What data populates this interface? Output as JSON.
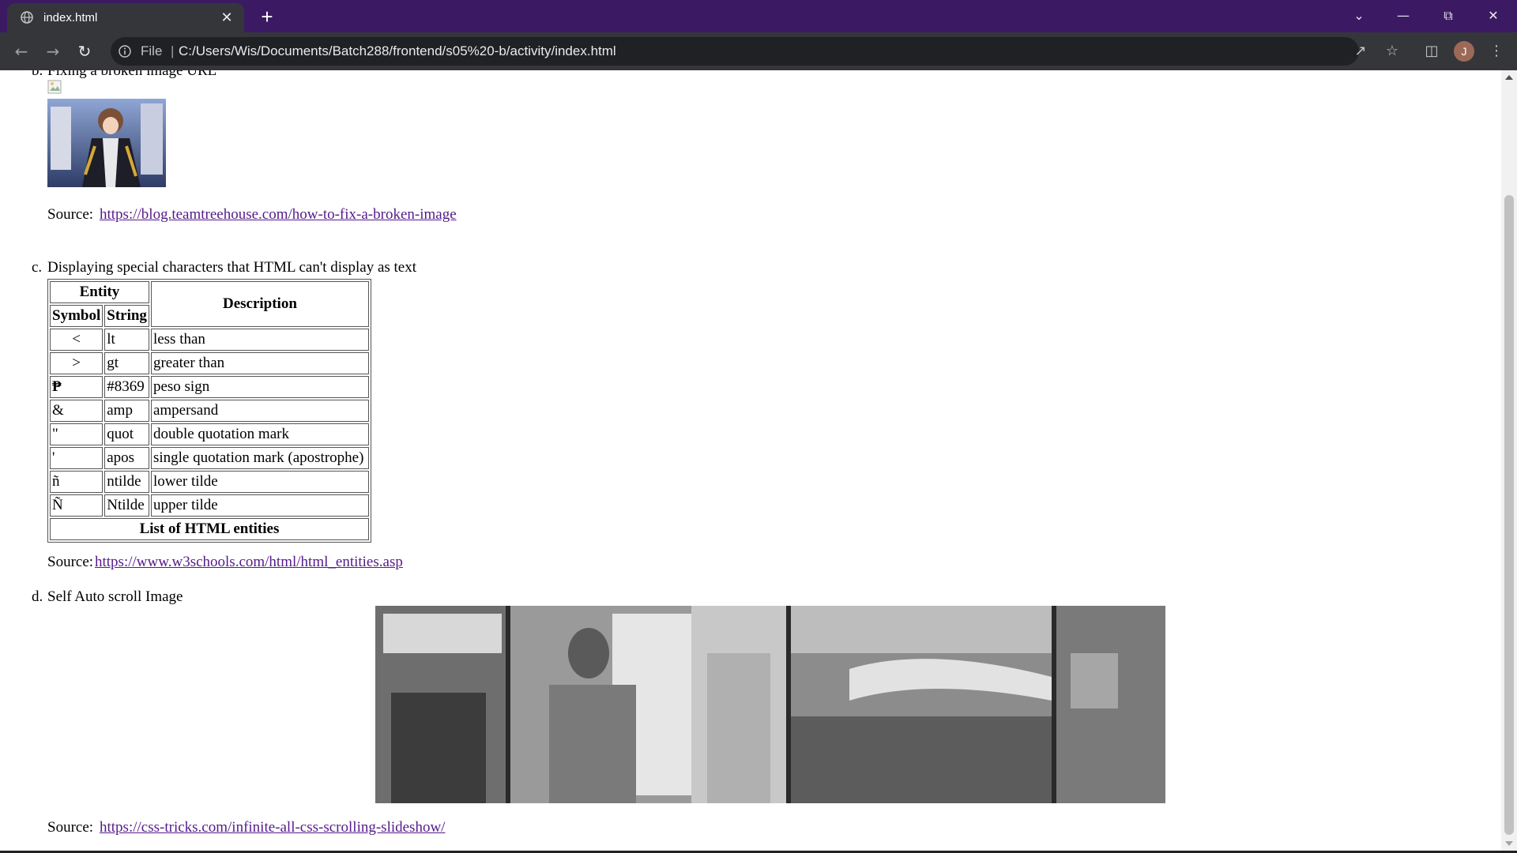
{
  "browser": {
    "tab_title": "index.html",
    "new_tab_label": "+",
    "tab_close_label": "✕",
    "address": {
      "scheme_label": "File",
      "separator": "|",
      "url": "C:/Users/Wis/Documents/Batch288/frontend/s05%20-b/activity/index.html"
    },
    "profile_initial": "J",
    "icons": [
      "globe-icon",
      "close-icon",
      "back-icon",
      "forward-icon",
      "reload-icon",
      "info-icon",
      "share-icon",
      "star-icon",
      "sidepanel-icon",
      "menu-icon",
      "chevron-down-icon",
      "minimize-icon",
      "restore-icon",
      "window-close-icon"
    ],
    "colors": {
      "tabbar": "#3b1a63",
      "toolbar": "#35363a",
      "omnibox": "#202124",
      "link": "#551a8b"
    }
  },
  "page": {
    "section_b": {
      "marker": "b.",
      "heading_partial": "Fixing a broken image URL",
      "source_label": "Source:",
      "source_link": "https://blog.teamtreehouse.com/how-to-fix-a-broken-image"
    },
    "section_c": {
      "marker": "c.",
      "heading": "Displaying special characters that HTML can't display as text",
      "table": {
        "head_entity": "Entity",
        "head_symbol": "Symbol",
        "head_string": "String",
        "head_description": "Description",
        "rows": [
          {
            "symbol": "<",
            "string": "lt",
            "description": "less than"
          },
          {
            "symbol": ">",
            "string": "gt",
            "description": "greater than"
          },
          {
            "symbol": "₱",
            "string": "#8369",
            "description": "peso sign"
          },
          {
            "symbol": "&",
            "string": "amp",
            "description": "ampersand"
          },
          {
            "symbol": "\"",
            "string": "quot",
            "description": "double quotation mark"
          },
          {
            "symbol": "'",
            "string": "apos",
            "description": "single quotation mark (apostrophe)"
          },
          {
            "symbol": "ñ",
            "string": "ntilde",
            "description": "lower tilde"
          },
          {
            "symbol": "Ñ",
            "string": "Ntilde",
            "description": "upper tilde"
          }
        ],
        "caption": "List of HTML entities"
      },
      "source_label": "Source:",
      "source_link": "https://www.w3schools.com/html/html_entities.asp"
    },
    "section_d": {
      "marker": "d.",
      "heading": "Self Auto scroll Image",
      "source_label": "Source:",
      "source_link": "https://css-tricks.com/infinite-all-css-scrolling-slideshow/"
    }
  }
}
